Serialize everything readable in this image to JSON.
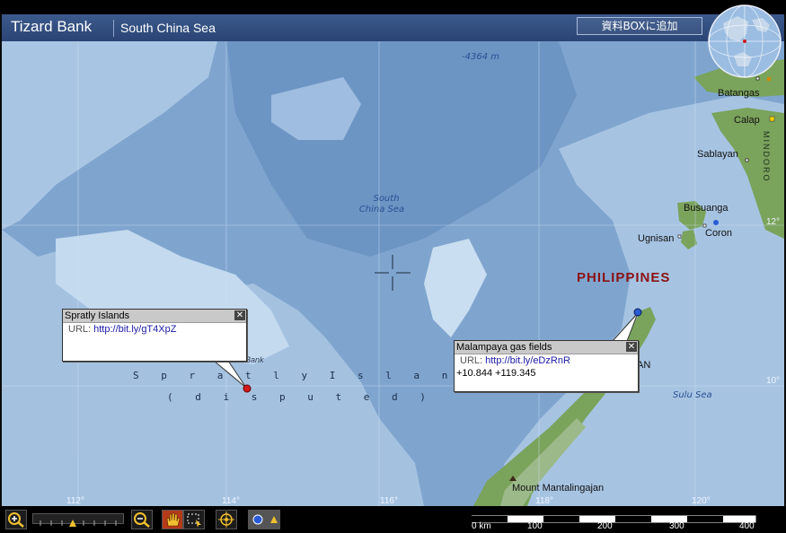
{
  "header": {
    "title": "Tizard Bank",
    "subtitle": "South China Sea",
    "box_button": "資料BOXに追加"
  },
  "map": {
    "depth_label": "-4364 m",
    "sea_label_line1": "South",
    "sea_label_line2": "China Sea",
    "sulu_sea": "Sulu Sea",
    "spratly_line1": "S p r a t l y   I s l a n d s",
    "spratly_line2": "( d i s p u t e d )",
    "bank_fragment": "Bank",
    "country": "PHILIPPINES",
    "places": {
      "batangas": "Batangas",
      "calapan": "Calap",
      "sablayan": "Sablayan",
      "busuanga": "Busuanga",
      "coron": "Coron",
      "ugnisan": "Ugnisan",
      "an_fragment": "AN",
      "mount": "Mount Mantalingajan",
      "mindoro": "MINDORO"
    },
    "lon_labels": [
      "112°",
      "114°",
      "116°",
      "118°",
      "120°"
    ],
    "lat_labels": [
      "12°",
      "10°"
    ]
  },
  "popups": {
    "spratly": {
      "title": "Spratly Islands",
      "url_label": "URL:",
      "url": "http://bit.ly/gT4XpZ"
    },
    "malampaya": {
      "title": "Malampaya gas fields",
      "url_label": "URL:",
      "url": "http://bit.ly/eDzRnR",
      "coords": "+10.844 +119.345"
    }
  },
  "scale": {
    "labels": [
      "0 km",
      "100",
      "200",
      "300",
      "400"
    ]
  },
  "icons": {
    "zoom_in": "zoom-in-icon",
    "zoom_out": "zoom-out-icon",
    "pan": "hand-icon",
    "select": "select-area-icon",
    "target": "target-icon",
    "layers": "layer-icon"
  },
  "colors": {
    "header": "#2f4b7c",
    "deep_sea": "#7fa5cf",
    "shallow": "#b7d2ea",
    "land": "#6f9a55",
    "country_label": "#8b1212",
    "marker": "#d21a1a"
  }
}
